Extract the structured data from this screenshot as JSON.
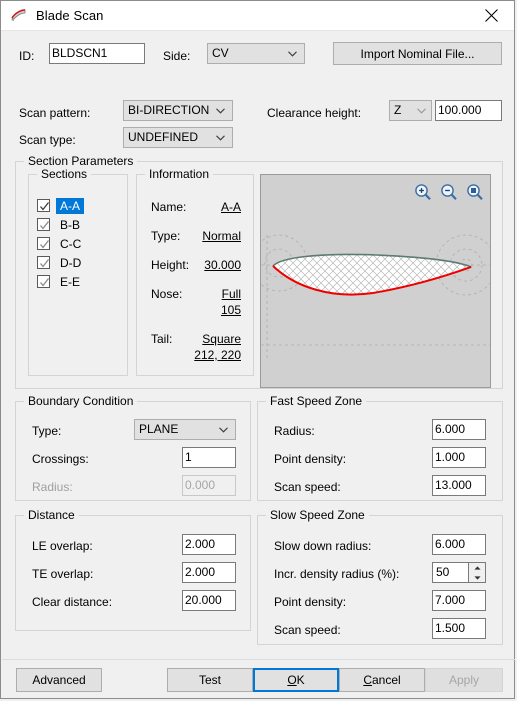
{
  "window": {
    "title": "Blade Scan",
    "icon": "blade-icon",
    "close_icon": "close-icon"
  },
  "header": {
    "id_label": "ID:",
    "id_value": "BLDSCN1",
    "side_label": "Side:",
    "side_value": "CV",
    "import_button": "Import Nominal File..."
  },
  "scan": {
    "pattern_label": "Scan pattern:",
    "pattern_value": "BI-DIRECTION",
    "type_label": "Scan type:",
    "type_value": "UNDEFINED",
    "clearance_label": "Clearance height:",
    "clearance_axis": "Z",
    "clearance_value": "100.000"
  },
  "section_parameters": {
    "title": "Section Parameters",
    "sections": {
      "title": "Sections",
      "items": [
        {
          "label": "A-A",
          "checked": true,
          "selected": true
        },
        {
          "label": "B-B",
          "checked": true,
          "selected": false
        },
        {
          "label": "C-C",
          "checked": true,
          "selected": false
        },
        {
          "label": "D-D",
          "checked": true,
          "selected": false
        },
        {
          "label": "E-E",
          "checked": true,
          "selected": false
        }
      ]
    },
    "information": {
      "title": "Information",
      "rows": [
        {
          "key": "Name:",
          "value": "A-A"
        },
        {
          "key": "Type:",
          "value": "Normal"
        },
        {
          "key": "Height:",
          "value": "30.000"
        },
        {
          "key": "Nose:",
          "value": "Full",
          "value2": "105"
        },
        {
          "key": "Tail:",
          "value": "Square",
          "value2": "212, 220"
        }
      ]
    },
    "preview": {
      "zoom_in_icon": "zoom-in-icon",
      "zoom_out_icon": "zoom-out-icon",
      "zoom_fit_icon": "zoom-fit-icon",
      "colors": {
        "background": "#d0d0d0",
        "suction_edge": "#5f7a72",
        "pressure_edge": "#ee0000",
        "fill": "#ffffff"
      }
    }
  },
  "boundary_condition": {
    "title": "Boundary Condition",
    "type_label": "Type:",
    "type_value": "PLANE",
    "crossings_label": "Crossings:",
    "crossings_value": "1",
    "radius_label": "Radius:",
    "radius_value": "0.000",
    "radius_disabled": true
  },
  "fast_speed_zone": {
    "title": "Fast Speed Zone",
    "rows": [
      {
        "label": "Radius:",
        "value": "6.000"
      },
      {
        "label": "Point density:",
        "value": "1.000"
      },
      {
        "label": "Scan speed:",
        "value": "13.000"
      }
    ]
  },
  "distance": {
    "title": "Distance",
    "rows": [
      {
        "label": "LE overlap:",
        "value": "2.000"
      },
      {
        "label": "TE overlap:",
        "value": "2.000"
      },
      {
        "label": "Clear distance:",
        "value": "20.000"
      }
    ]
  },
  "slow_speed_zone": {
    "title": "Slow Speed Zone",
    "rows": [
      {
        "label": "Slow down radius:",
        "value": "6.000"
      },
      {
        "label": "Incr. density radius (%):",
        "value": "50",
        "spinner": true
      },
      {
        "label": "Point density:",
        "value": "7.000"
      },
      {
        "label": "Scan speed:",
        "value": "1.500"
      }
    ]
  },
  "footer": {
    "advanced": "Advanced",
    "test": "Test",
    "ok": "OK",
    "cancel": "Cancel",
    "apply": "Apply"
  }
}
